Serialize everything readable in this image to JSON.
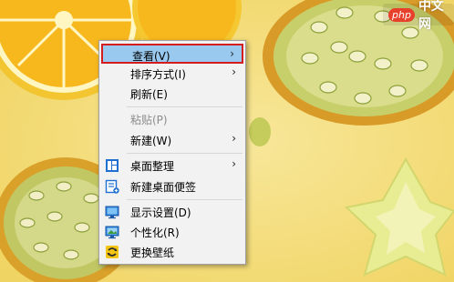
{
  "watermark": {
    "logo": "php",
    "text": "中文网"
  },
  "menu": {
    "items": [
      {
        "label": "查看(V)",
        "submenu": true,
        "selected": true
      },
      {
        "label": "排序方式(I)",
        "submenu": true
      },
      {
        "label": "刷新(E)"
      },
      {
        "label": "粘贴(P)",
        "disabled": true
      },
      {
        "label": "新建(W)",
        "submenu": true
      },
      {
        "label": "桌面整理",
        "submenu": true,
        "icon": "desktop-organize-icon"
      },
      {
        "label": "新建桌面便签",
        "icon": "desktop-note-icon"
      },
      {
        "label": "显示设置(D)",
        "icon": "display-settings-icon"
      },
      {
        "label": "个性化(R)",
        "icon": "personalize-icon"
      },
      {
        "label": "更换壁纸",
        "icon": "change-wallpaper-icon"
      }
    ],
    "arrow_glyph": "›"
  },
  "colors": {
    "selection_bg": "#99c9ef",
    "selection_border": "#d41c1c",
    "menu_bg": "#f2f2f2"
  }
}
